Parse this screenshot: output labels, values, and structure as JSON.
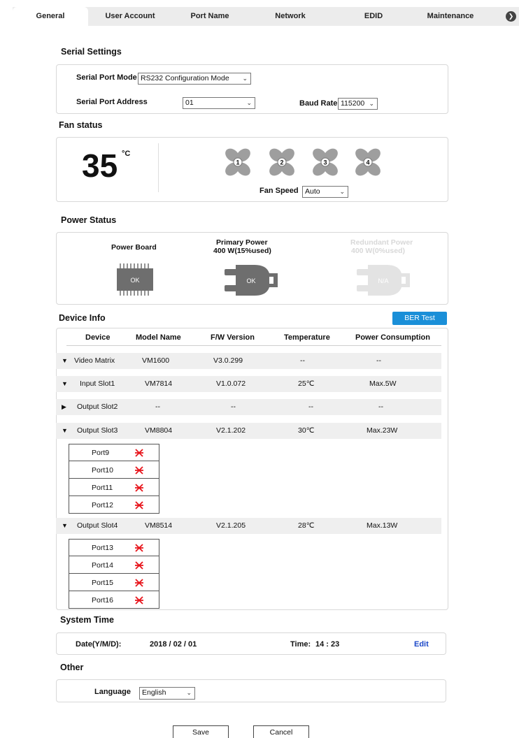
{
  "tabs": [
    {
      "label": "General",
      "active": true
    },
    {
      "label": "User Account"
    },
    {
      "label": "Port Name"
    },
    {
      "label": "Network"
    },
    {
      "label": "EDID"
    },
    {
      "label": "Maintenance"
    }
  ],
  "serial": {
    "title": "Serial Settings",
    "mode_label": "Serial Port Mode",
    "mode_value": "RS232 Configuration Mode",
    "address_label": "Serial Port Address",
    "address_value": "01",
    "baud_label": "Baud Rate",
    "baud_value": "115200"
  },
  "fan": {
    "title": "Fan status",
    "temperature": "35",
    "unit": "°C",
    "fans": [
      "1",
      "2",
      "3",
      "4"
    ],
    "speed_label": "Fan Speed",
    "speed_value": "Auto"
  },
  "power": {
    "title": "Power Status",
    "board_label": "Power Board",
    "board_status": "OK",
    "primary_label": "Primary Power",
    "primary_sub": "400 W(15%used)",
    "primary_status": "OK",
    "redundant_label": "Redundant Power",
    "redundant_sub": "400 W(0%used)",
    "redundant_status": "N/A"
  },
  "device": {
    "title": "Device Info",
    "ber_button": "BER Test",
    "headers": [
      "Device",
      "Model Name",
      "F/W Version",
      "Temperature",
      "Power Consumption"
    ],
    "rows": [
      {
        "expanded": true,
        "device": "Video Matrix",
        "model": "VM1600",
        "fw": "V3.0.299",
        "temp": "--",
        "power": "--"
      },
      {
        "expanded": true,
        "device": "Input Slot1",
        "model": "VM7814",
        "fw": "V1.0.072",
        "temp": "25℃",
        "power": "Max.5W"
      },
      {
        "expanded": false,
        "device": "Output Slot2",
        "model": "--",
        "fw": "--",
        "temp": "--",
        "power": "--"
      },
      {
        "expanded": true,
        "device": "Output Slot3",
        "model": "VM8804",
        "fw": "V2.1.202",
        "temp": "30℃",
        "power": "Max.23W"
      },
      {
        "expanded": true,
        "device": "Output Slot4",
        "model": "VM8514",
        "fw": "V2.1.205",
        "temp": "28℃",
        "power": "Max.13W"
      }
    ],
    "ports_slot3": [
      "Port9",
      "Port10",
      "Port11",
      "Port12"
    ],
    "ports_slot4": [
      "Port13",
      "Port14",
      "Port15",
      "Port16"
    ]
  },
  "time": {
    "title": "System Time",
    "date_label": "Date(Y/M/D):",
    "date_value": "2018 / 02 / 01",
    "time_label": "Time:",
    "time_value": "14 : 23",
    "edit": "Edit"
  },
  "other": {
    "title": "Other",
    "language_label": "Language",
    "language_value": "English"
  },
  "actions": {
    "save": "Save",
    "cancel": "Cancel"
  },
  "colors": {
    "accent": "#1a8fd8",
    "link": "#1b47c8",
    "error": "#e8141b",
    "device_gray": "#6e6e6e",
    "disabled_gray": "#e3e3e3"
  }
}
